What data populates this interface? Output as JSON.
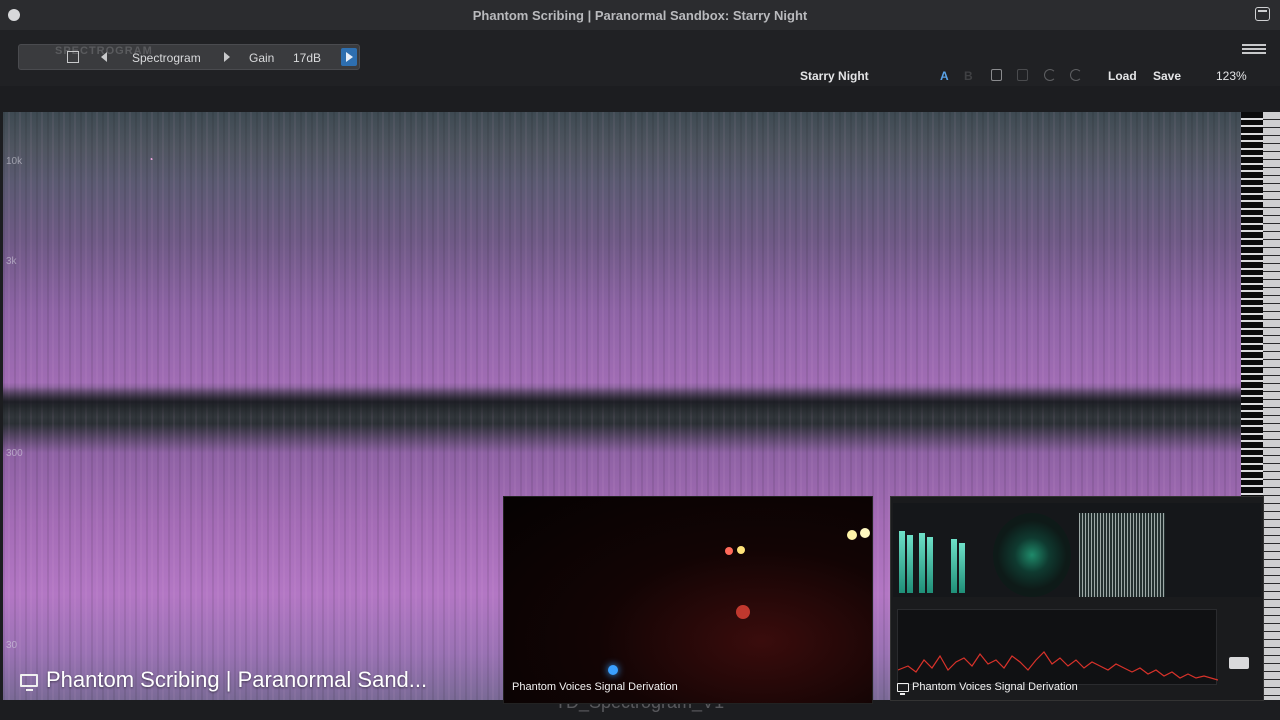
{
  "window": {
    "title": "Phantom Scribing | Paranormal Sandbox: Starry Night"
  },
  "plugin_bar": {
    "logo_text": "SPECTROGRAM",
    "view_label": "Spectrogram",
    "gain_label": "Gain",
    "gain_value": "17dB"
  },
  "toolbar": {
    "preset_name": "Starry Night",
    "ab_a": "A",
    "ab_b": "B",
    "load_label": "Load",
    "save_label": "Save",
    "zoom": "123%"
  },
  "spectrogram": {
    "freq_labels": [
      "10k",
      "3k",
      "300",
      "30"
    ]
  },
  "video_left": {
    "caption": "Phantom Voices Signal Derivation"
  },
  "video_right": {
    "caption": "Phantom Voices Signal Derivation"
  },
  "main_caption": "Phantom Scribing | Paranormal Sand...",
  "ghost_text": "TD_Spectrogram_V1",
  "colors": {
    "accent_blue": "#5aa3e8",
    "spectrogram_pink": "#b377c4",
    "play_button": "#2e6fb0"
  }
}
